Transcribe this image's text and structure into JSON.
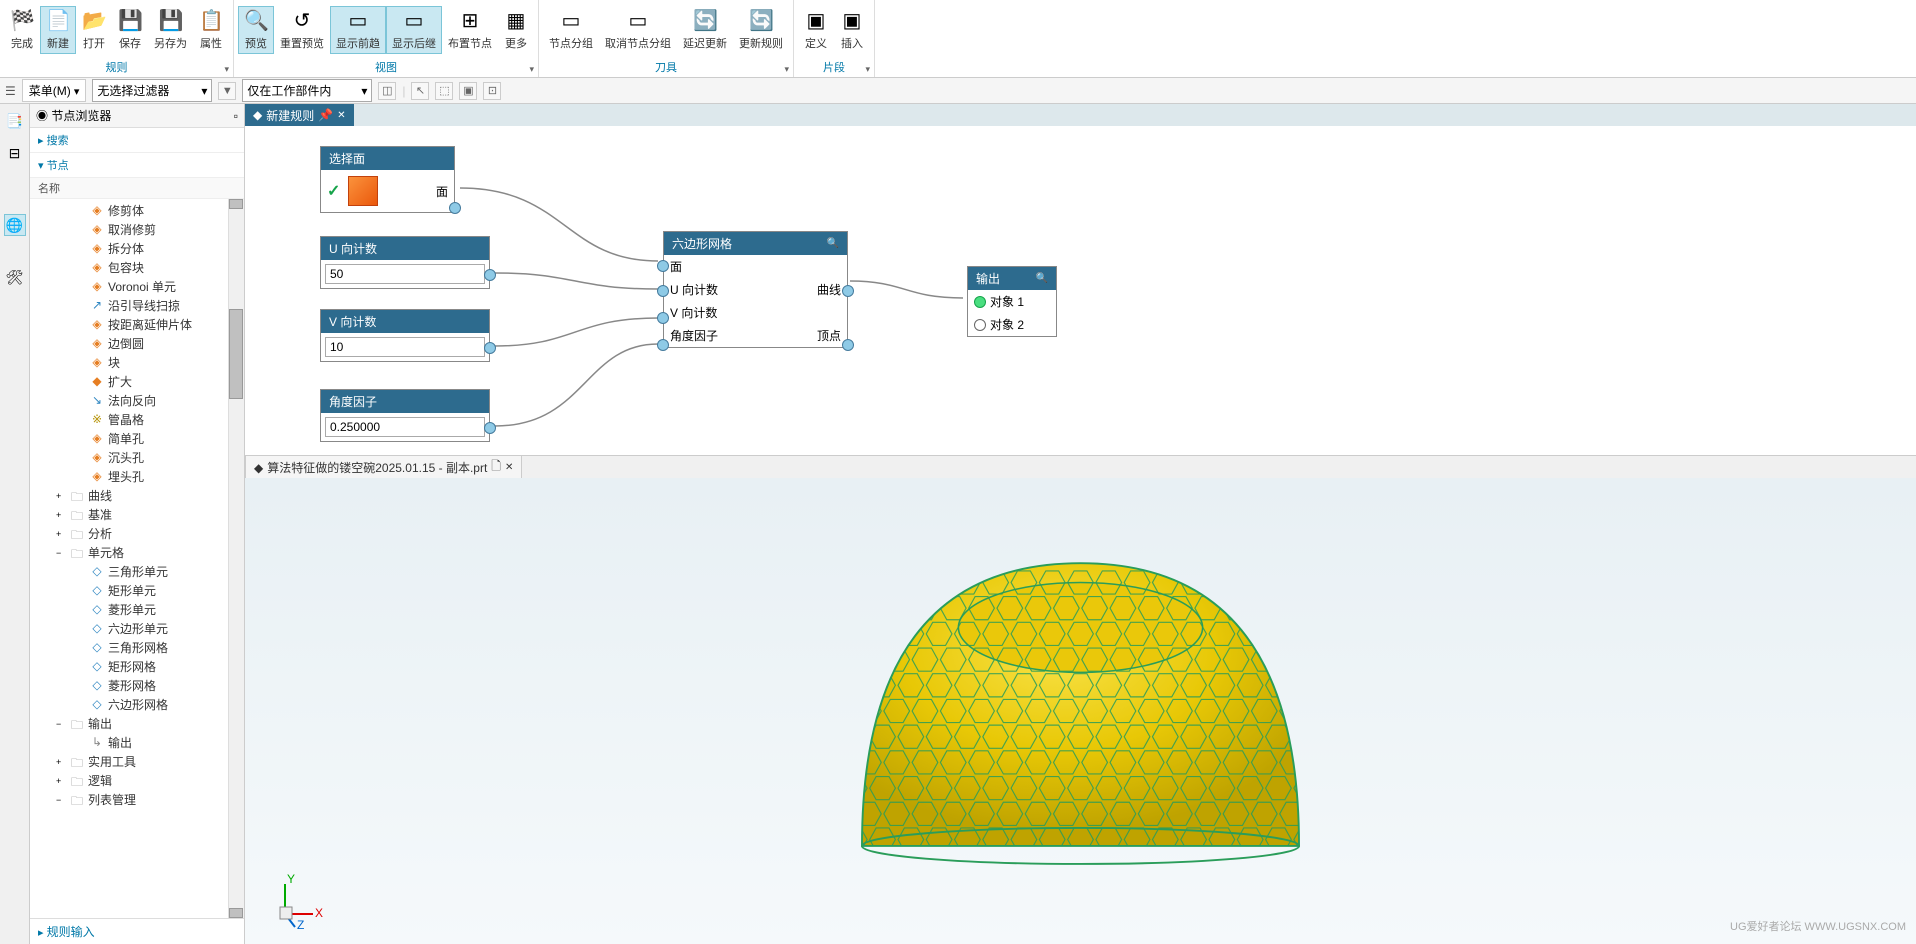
{
  "ribbon": {
    "groups": [
      {
        "caption": "规则",
        "btns": [
          {
            "lbl": "完成",
            "ico": "🏁"
          },
          {
            "lbl": "新建",
            "ico": "📄",
            "active": true
          },
          {
            "lbl": "打开",
            "ico": "📂"
          },
          {
            "lbl": "保存",
            "ico": "💾"
          },
          {
            "lbl": "另存为",
            "ico": "💾"
          },
          {
            "lbl": "属性",
            "ico": "📋"
          }
        ]
      },
      {
        "caption": "视图",
        "btns": [
          {
            "lbl": "预览",
            "ico": "🔍",
            "active": true
          },
          {
            "lbl": "重置预览",
            "ico": "↺"
          },
          {
            "lbl": "显示前趋",
            "ico": "▭",
            "active": true
          },
          {
            "lbl": "显示后继",
            "ico": "▭",
            "active": true
          },
          {
            "lbl": "布置节点",
            "ico": "⊞"
          },
          {
            "lbl": "更多",
            "ico": "▦"
          }
        ]
      },
      {
        "caption": "刀具",
        "btns": [
          {
            "lbl": "节点分组",
            "ico": "▭"
          },
          {
            "lbl": "取消节点分组",
            "ico": "▭"
          },
          {
            "lbl": "延迟更新",
            "ico": "🔄"
          },
          {
            "lbl": "更新规则",
            "ico": "🔄"
          }
        ]
      },
      {
        "caption": "片段",
        "btns": [
          {
            "lbl": "定义",
            "ico": "▣"
          },
          {
            "lbl": "插入",
            "ico": "▣"
          }
        ]
      }
    ]
  },
  "filterbar": {
    "menu": "菜单(M)",
    "filter1": "无选择过滤器",
    "filter2": "仅在工作部件内"
  },
  "leftPanel": {
    "title": "节点浏览器",
    "secSearch": "搜索",
    "secNodes": "节点",
    "colName": "名称",
    "items": [
      {
        "ico": "◈",
        "col": "ic-orange",
        "lbl": "修剪体",
        "ind": 4
      },
      {
        "ico": "◈",
        "col": "ic-orange",
        "lbl": "取消修剪",
        "ind": 4
      },
      {
        "ico": "◈",
        "col": "ic-orange",
        "lbl": "拆分体",
        "ind": 4
      },
      {
        "ico": "◈",
        "col": "ic-orange",
        "lbl": "包容块",
        "ind": 4
      },
      {
        "ico": "◈",
        "col": "ic-orange",
        "lbl": "Voronoi 单元",
        "ind": 4
      },
      {
        "ico": "↗",
        "col": "ic-blue",
        "lbl": "沿引导线扫掠",
        "ind": 4
      },
      {
        "ico": "◈",
        "col": "ic-orange",
        "lbl": "按距离延伸片体",
        "ind": 4
      },
      {
        "ico": "◈",
        "col": "ic-orange",
        "lbl": "边倒圆",
        "ind": 4
      },
      {
        "ico": "◈",
        "col": "ic-orange",
        "lbl": "块",
        "ind": 4
      },
      {
        "ico": "◆",
        "col": "ic-orange",
        "lbl": "扩大",
        "ind": 4
      },
      {
        "ico": "↘",
        "col": "ic-blue",
        "lbl": "法向反向",
        "ind": 4
      },
      {
        "ico": "※",
        "col": "ic-yellow",
        "lbl": "管晶格",
        "ind": 4
      },
      {
        "ico": "◈",
        "col": "ic-orange",
        "lbl": "简单孔",
        "ind": 4
      },
      {
        "ico": "◈",
        "col": "ic-orange",
        "lbl": "沉头孔",
        "ind": 4
      },
      {
        "ico": "◈",
        "col": "ic-orange",
        "lbl": "埋头孔",
        "ind": 4
      },
      {
        "tg": "+",
        "ico": "🗀",
        "col": "ic-folder",
        "lbl": "曲线",
        "ind": 2
      },
      {
        "tg": "+",
        "ico": "🗀",
        "col": "ic-folder",
        "lbl": "基准",
        "ind": 2
      },
      {
        "tg": "+",
        "ico": "🗀",
        "col": "ic-folder",
        "lbl": "分析",
        "ind": 2
      },
      {
        "tg": "−",
        "ico": "🗀",
        "col": "ic-folder",
        "lbl": "单元格",
        "ind": 2
      },
      {
        "ico": "◇",
        "col": "ic-blue",
        "lbl": "三角形单元",
        "ind": 4
      },
      {
        "ico": "◇",
        "col": "ic-blue",
        "lbl": "矩形单元",
        "ind": 4
      },
      {
        "ico": "◇",
        "col": "ic-blue",
        "lbl": "菱形单元",
        "ind": 4
      },
      {
        "ico": "◇",
        "col": "ic-blue",
        "lbl": "六边形单元",
        "ind": 4
      },
      {
        "ico": "◇",
        "col": "ic-blue",
        "lbl": "三角形网格",
        "ind": 4
      },
      {
        "ico": "◇",
        "col": "ic-blue",
        "lbl": "矩形网格",
        "ind": 4
      },
      {
        "ico": "◇",
        "col": "ic-blue",
        "lbl": "菱形网格",
        "ind": 4
      },
      {
        "ico": "◇",
        "col": "ic-blue",
        "lbl": "六边形网格",
        "ind": 4
      },
      {
        "tg": "−",
        "ico": "🗀",
        "col": "ic-folder",
        "lbl": "输出",
        "ind": 2
      },
      {
        "ico": "↳",
        "col": "ic-folder",
        "lbl": "输出",
        "ind": 4
      },
      {
        "tg": "+",
        "ico": "🗀",
        "col": "ic-folder",
        "lbl": "实用工具",
        "ind": 2
      },
      {
        "tg": "+",
        "ico": "🗀",
        "col": "ic-folder",
        "lbl": "逻辑",
        "ind": 2
      },
      {
        "tg": "−",
        "ico": "🗀",
        "col": "ic-folder",
        "lbl": "列表管理",
        "ind": 2
      }
    ],
    "footer": "规则输入"
  },
  "tabs": {
    "ruleTab": "新建规则",
    "partTab": "算法特征做的镂空碗2025.01.15 - 副本.prt"
  },
  "nodes": {
    "selectFace": {
      "title": "选择面",
      "outLbl": "面"
    },
    "uCount": {
      "title": "U 向计数",
      "value": "50"
    },
    "vCount": {
      "title": "V 向计数",
      "value": "10"
    },
    "angleFactor": {
      "title": "角度因子",
      "value": "0.250000"
    },
    "hexMesh": {
      "title": "六边形网格",
      "in1": "面",
      "in2": "U 向计数",
      "in3": "V 向计数",
      "in4": "角度因子",
      "out1": "曲线",
      "out2": "顶点"
    },
    "output": {
      "title": "输出",
      "p1": "对象 1",
      "p2": "对象 2"
    }
  },
  "watermark": "UG爱好者论坛  WWW.UGSNX.COM"
}
